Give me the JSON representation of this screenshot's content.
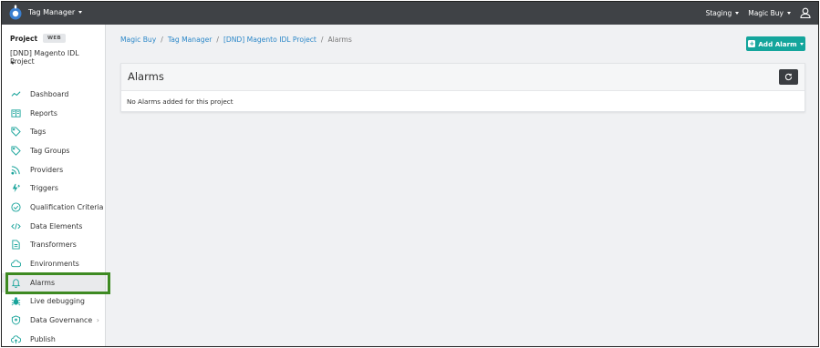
{
  "topbar": {
    "app_name": "Tag Manager",
    "environment": "Staging",
    "account": "Magic Buy"
  },
  "sidebar": {
    "project_label": "Project",
    "project_badge": "WEB",
    "project_name": "[DND] Magento IDL Project",
    "items": [
      {
        "label": "Dashboard",
        "icon": "chart-line-icon"
      },
      {
        "label": "Reports",
        "icon": "book-icon"
      },
      {
        "label": "Tags",
        "icon": "tag-icon"
      },
      {
        "label": "Tag Groups",
        "icon": "tags-icon"
      },
      {
        "label": "Providers",
        "icon": "rss-icon"
      },
      {
        "label": "Triggers",
        "icon": "bolt-icon"
      },
      {
        "label": "Qualification Criteria",
        "icon": "check-circle-icon"
      },
      {
        "label": "Data Elements",
        "icon": "code-icon"
      },
      {
        "label": "Transformers",
        "icon": "document-icon"
      },
      {
        "label": "Environments",
        "icon": "cloud-icon"
      },
      {
        "label": "Alarms",
        "icon": "bell-icon"
      },
      {
        "label": "Live debugging",
        "icon": "bug-icon"
      },
      {
        "label": "Data Governance",
        "icon": "shield-icon"
      },
      {
        "label": "Publish",
        "icon": "cloud-upload-icon"
      }
    ]
  },
  "breadcrumb": {
    "items": [
      "Magic Buy",
      "Tag Manager",
      "[DND] Magento IDL Project"
    ],
    "current": "Alarms"
  },
  "main": {
    "add_button": "Add Alarm",
    "card_title": "Alarms",
    "empty_message": "No Alarms added for this project"
  },
  "colors": {
    "accent": "#14a59c",
    "topbar": "#3f4246",
    "highlight": "#3e8a22",
    "link": "#2b87c8"
  }
}
